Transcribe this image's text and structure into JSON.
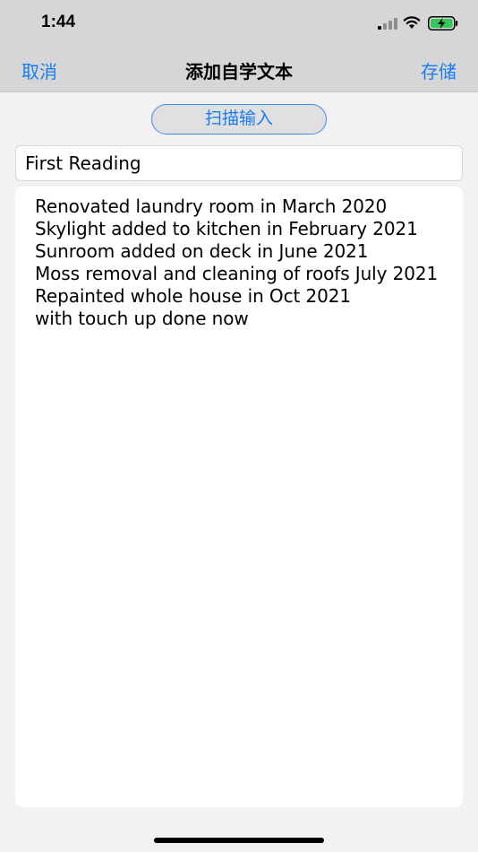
{
  "status_bar": {
    "time": "1:44",
    "icons": [
      "signal-icon",
      "wifi-icon",
      "battery-charging-icon"
    ],
    "battery_color": "#34c759"
  },
  "nav": {
    "cancel_label": "取消",
    "title": "添加自学文本",
    "save_label": "存储",
    "accent_color": "#1a7cf5"
  },
  "scan_button": {
    "label": "扫描输入"
  },
  "title_field": {
    "value": "First Reading"
  },
  "body_field": {
    "value": "Renovated laundry room in March 2020\nSkylight added to kitchen in February 2021\nSunroom added on deck in June 2021\nMoss removal and cleaning of roofs July 2021\nRepainted whole house in Oct 2021\nwith touch up done now"
  }
}
